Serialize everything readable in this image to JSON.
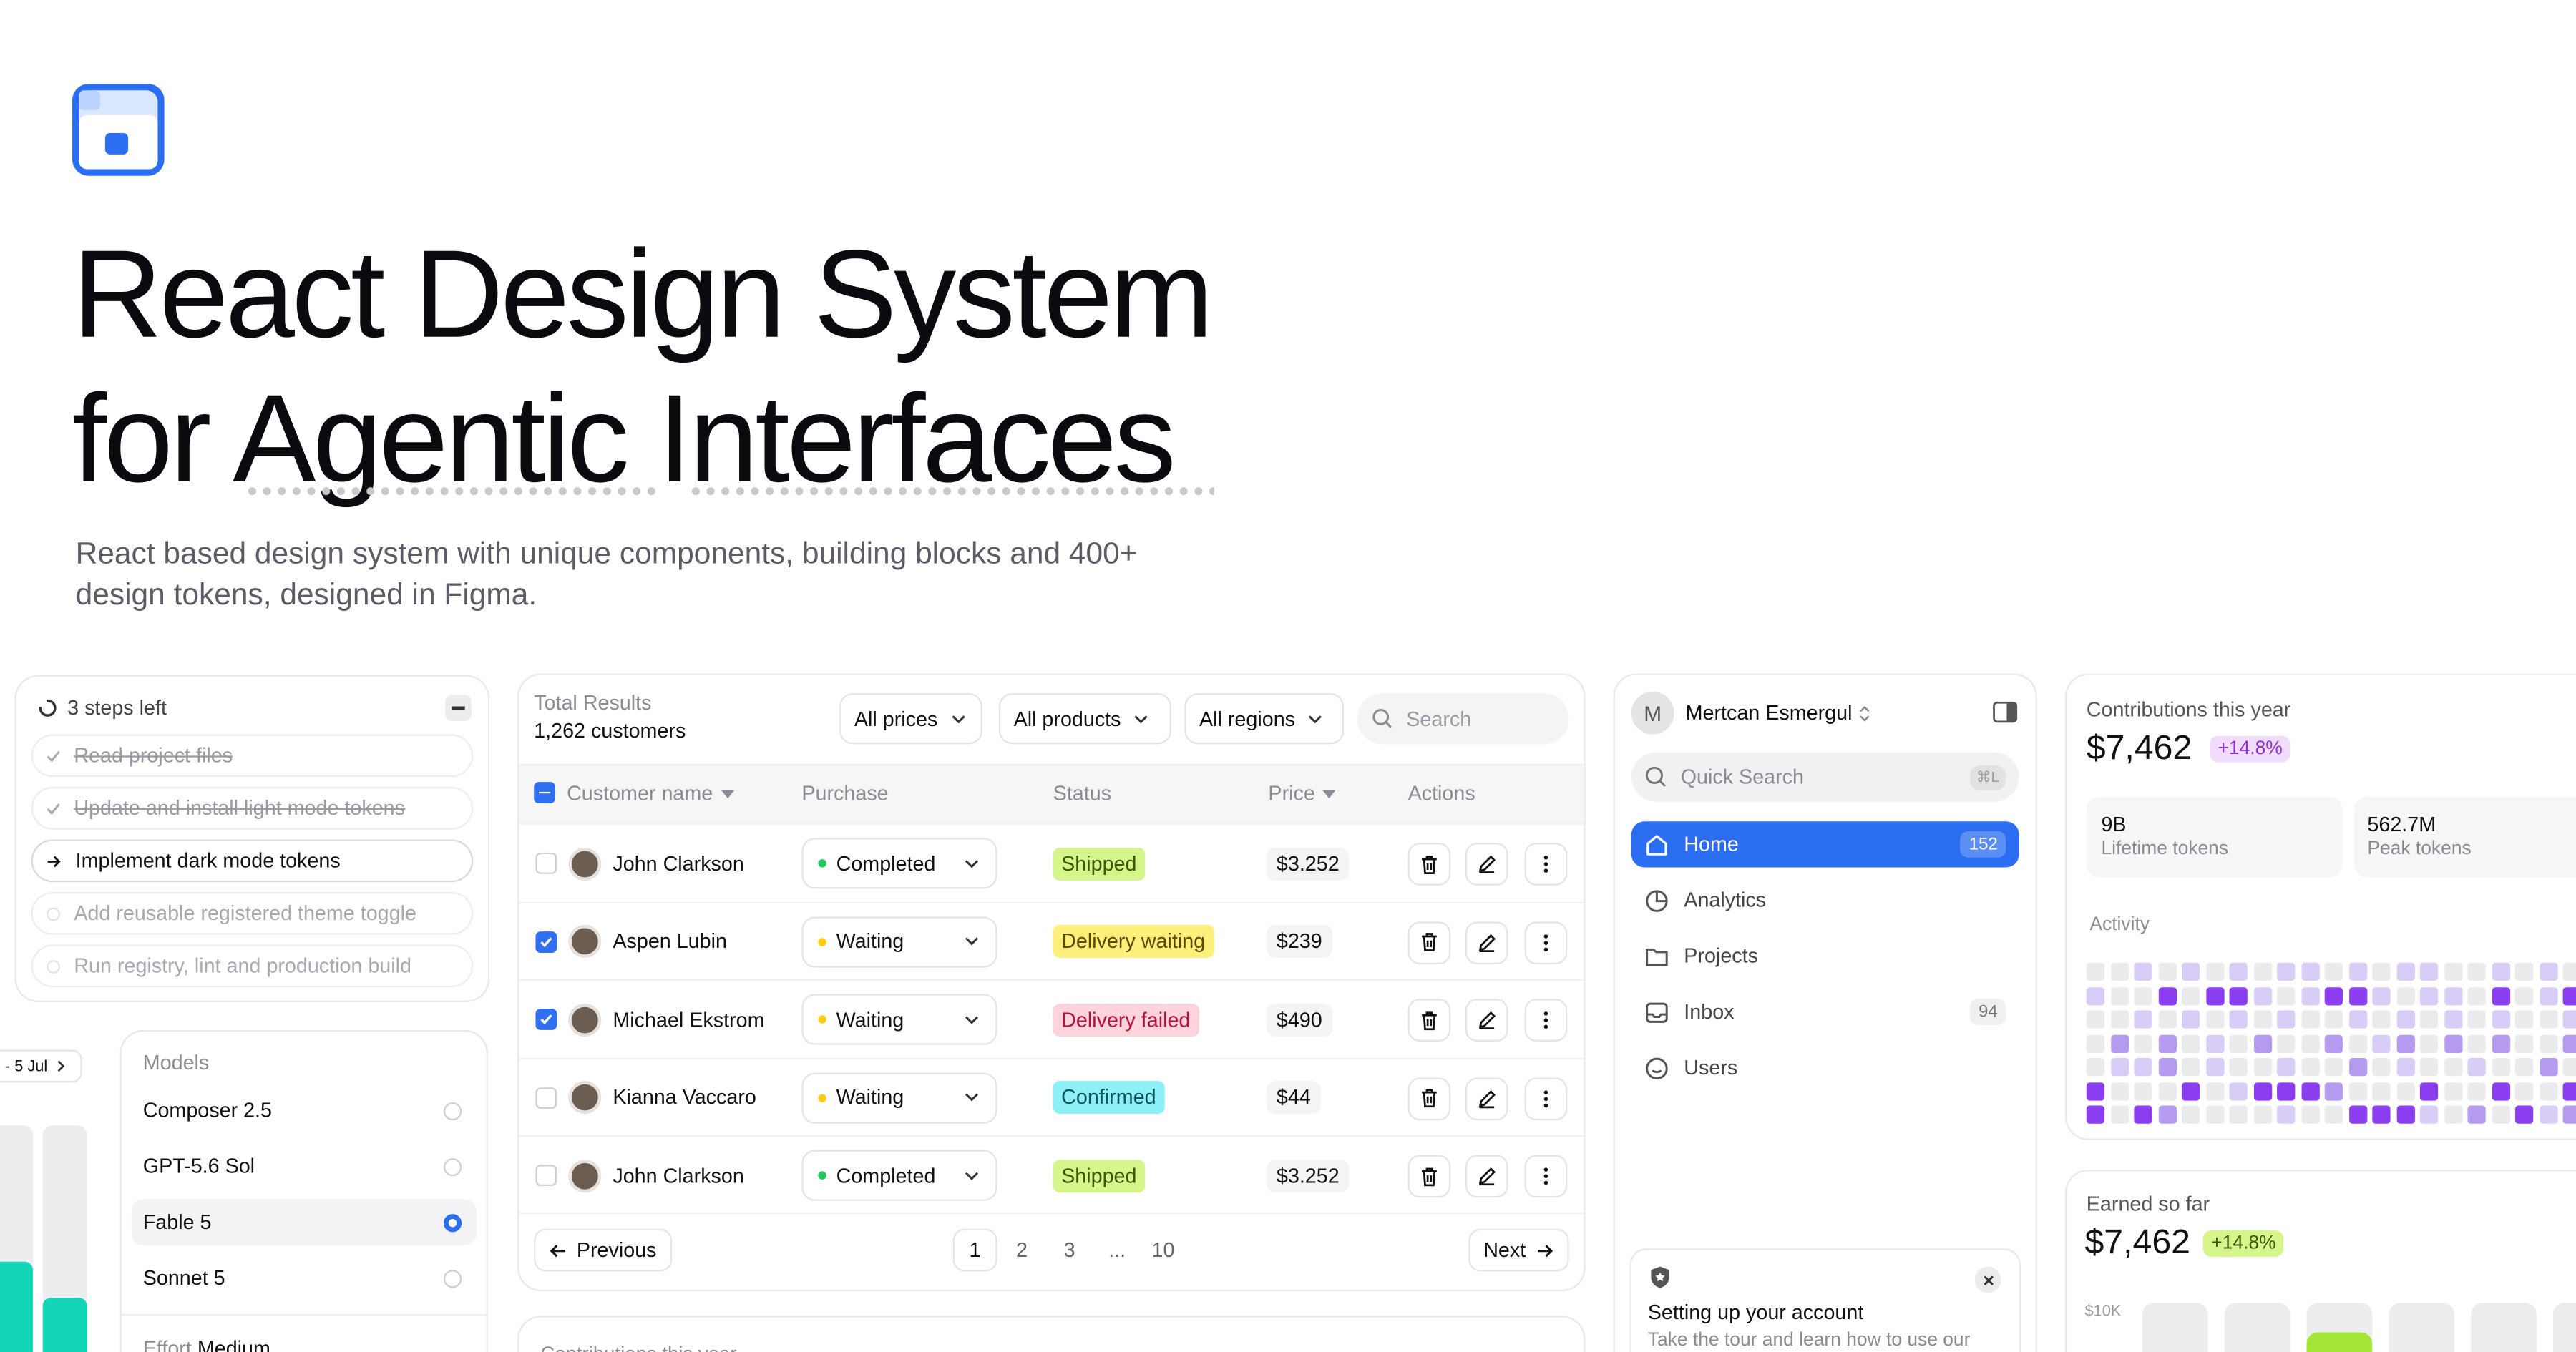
{
  "hero": {
    "title_line1": "React Design System",
    "title_line2": "for Agentic Interfaces",
    "subtitle": "React based design system with unique components, building blocks and 400+ design tokens, designed in Figma."
  },
  "steps": {
    "header": "3 steps left",
    "items": [
      {
        "label": "Read project files",
        "state": "done"
      },
      {
        "label": "Update and install light mode tokens",
        "state": "done"
      },
      {
        "label": "Implement dark mode tokens",
        "state": "active"
      },
      {
        "label": "Add reusable registered theme toggle",
        "state": "pending"
      },
      {
        "label": "Run registry, lint and production build",
        "state": "pending"
      }
    ]
  },
  "date_picker": {
    "label": "- 5 Jul"
  },
  "models": {
    "title": "Models",
    "items": [
      {
        "label": "Composer 2.5",
        "selected": false
      },
      {
        "label": "GPT-5.6 Sol",
        "selected": false
      },
      {
        "label": "Fable 5",
        "selected": true
      },
      {
        "label": "Sonnet 5",
        "selected": false
      }
    ],
    "effort_label": "Effort",
    "effort_value": "Medium"
  },
  "table": {
    "total_label": "Total Results",
    "total_value": "1,262 customers",
    "filters": [
      "All prices",
      "All products",
      "All regions"
    ],
    "search_placeholder": "Search",
    "columns": [
      "Customer name",
      "Purchase",
      "Status",
      "Price",
      "Actions"
    ],
    "rows": [
      {
        "name": "John Clarkson",
        "checked": false,
        "purchase": "Completed",
        "purchase_color": "#22c55e",
        "status": "Shipped",
        "status_bg": "#d6f58a",
        "status_fg": "#3b5a00",
        "price": "$3.252"
      },
      {
        "name": "Aspen Lubin",
        "checked": true,
        "purchase": "Waiting",
        "purchase_color": "#facc15",
        "status": "Delivery waiting",
        "status_bg": "#fdf07a",
        "status_fg": "#5a4a00",
        "price": "$239"
      },
      {
        "name": "Michael Ekstrom",
        "checked": true,
        "purchase": "Waiting",
        "purchase_color": "#facc15",
        "status": "Delivery failed",
        "status_bg": "#fdd3dc",
        "status_fg": "#b4123a",
        "price": "$490"
      },
      {
        "name": "Kianna Vaccaro",
        "checked": false,
        "purchase": "Waiting",
        "purchase_color": "#facc15",
        "status": "Confirmed",
        "status_bg": "#8ef0f7",
        "status_fg": "#0a5560",
        "price": "$44"
      },
      {
        "name": "John Clarkson",
        "checked": false,
        "purchase": "Completed",
        "purchase_color": "#22c55e",
        "status": "Shipped",
        "status_bg": "#d6f58a",
        "status_fg": "#3b5a00",
        "price": "$3.252"
      }
    ],
    "previous_label": "Previous",
    "next_label": "Next",
    "pages": [
      "1",
      "2",
      "3",
      "...",
      "10"
    ],
    "current_page": "1"
  },
  "contributions_bottom": {
    "title": "Contributions this year"
  },
  "sidebar": {
    "user_initial": "M",
    "user_name": "Mertcan Esmergul",
    "search_placeholder": "Quick Search",
    "search_shortcut": "⌘L",
    "items": [
      {
        "label": "Home",
        "count": "152",
        "active": true,
        "icon": "home-icon"
      },
      {
        "label": "Analytics",
        "count": "",
        "active": false,
        "icon": "pie-chart-icon"
      },
      {
        "label": "Projects",
        "count": "",
        "active": false,
        "icon": "folder-icon"
      },
      {
        "label": "Inbox",
        "count": "94",
        "active": false,
        "icon": "inbox-icon"
      },
      {
        "label": "Users",
        "count": "",
        "active": false,
        "icon": "smile-icon"
      }
    ],
    "onboarding_title": "Setting up your account",
    "onboarding_text": "Take the tour and learn how to use our"
  },
  "contributions": {
    "title": "Contributions this year",
    "value": "$7,462",
    "delta": "+14.8%",
    "stats": [
      {
        "value": "9B",
        "label": "Lifetime tokens"
      },
      {
        "value": "562.7M",
        "label": "Peak tokens"
      }
    ],
    "activity_label": "Activity",
    "activity_levels": [
      0,
      0,
      1,
      0,
      1,
      0,
      1,
      0,
      1,
      1,
      0,
      1,
      0,
      1,
      1,
      0,
      0,
      1,
      0,
      1,
      0,
      1,
      0,
      0,
      3,
      0,
      3,
      3,
      1,
      0,
      1,
      3,
      3,
      1,
      0,
      1,
      1,
      0,
      3,
      0,
      1,
      3,
      0,
      0,
      1,
      0,
      1,
      0,
      1,
      0,
      1,
      0,
      0,
      1,
      0,
      1,
      0,
      1,
      0,
      1,
      0,
      0,
      1,
      0,
      2,
      0,
      2,
      0,
      1,
      0,
      2,
      0,
      0,
      2,
      0,
      1,
      2,
      0,
      2,
      0,
      2,
      0,
      0,
      2,
      0,
      1,
      1,
      2,
      0,
      1,
      0,
      0,
      1,
      0,
      0,
      2,
      0,
      1,
      0,
      0,
      1,
      0,
      0,
      2,
      0,
      3,
      0,
      0,
      0,
      3,
      0,
      1,
      3,
      3,
      3,
      2,
      0,
      0,
      0,
      3,
      0,
      0,
      3,
      0,
      0,
      3,
      3,
      0,
      3,
      2,
      0,
      0,
      0,
      0,
      1,
      0,
      0,
      3,
      3,
      3,
      1,
      0,
      2,
      0,
      3,
      1,
      2
    ],
    "activity_colors": [
      "#ebebee",
      "#d8cdf7",
      "#b59bf0",
      "#8b3ef0"
    ]
  },
  "earned": {
    "title": "Earned so far",
    "value": "$7,462",
    "delta": "+14.8%",
    "axis_label": "$10K"
  },
  "colors": {
    "accent": "#2b6ef2",
    "purple": "#8b3ef0",
    "lime": "#c4f04a"
  }
}
